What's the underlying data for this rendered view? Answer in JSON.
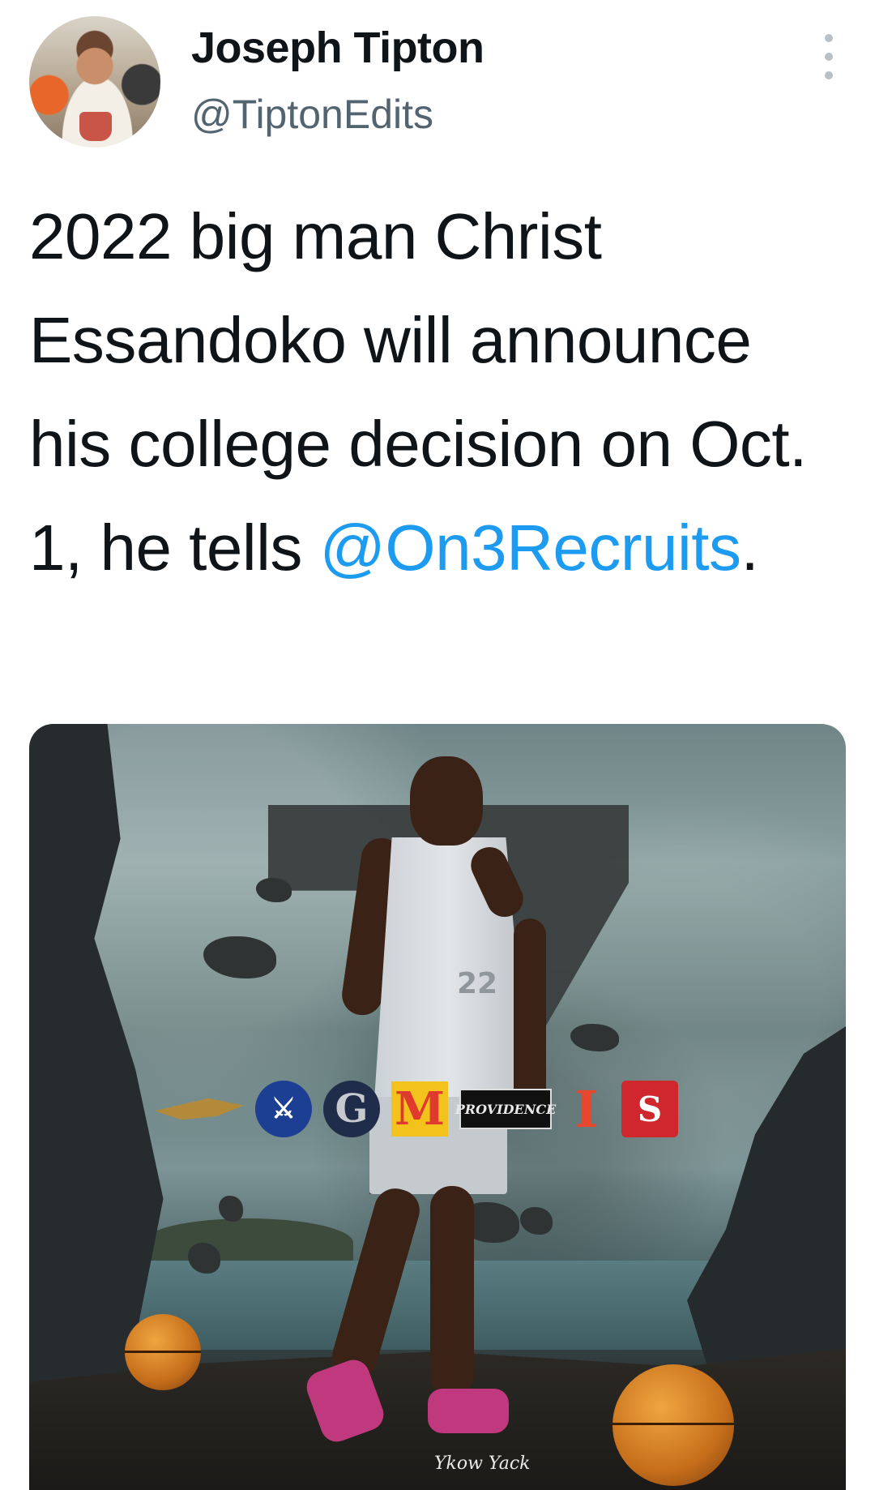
{
  "tweet": {
    "author_name": "Joseph Tipton",
    "author_handle": "@TiptonEdits",
    "text_before_mention": "2022 big man Christ Essandoko will announce his college decision on Oct. 1, he tells ",
    "mention": "@On3Recruits",
    "text_after_mention": ".",
    "more_icon": "more-vertical-icon"
  },
  "media": {
    "jersey_number": "22",
    "school_logos": [
      "eagle-logo",
      "seton-hall-logo",
      "georgetown-logo",
      "maryland-logo",
      "providence-logo",
      "illinois-logo",
      "nc-state-logo"
    ],
    "logo_text": {
      "g": "G",
      "m": "M",
      "providence": "PROVIDENCE",
      "i": "I",
      "ncs": "S"
    },
    "signature": "Ykow Yack"
  },
  "colors": {
    "link": "#1d9bf0",
    "secondary_text": "#536471",
    "primary_text": "#0f1419"
  }
}
